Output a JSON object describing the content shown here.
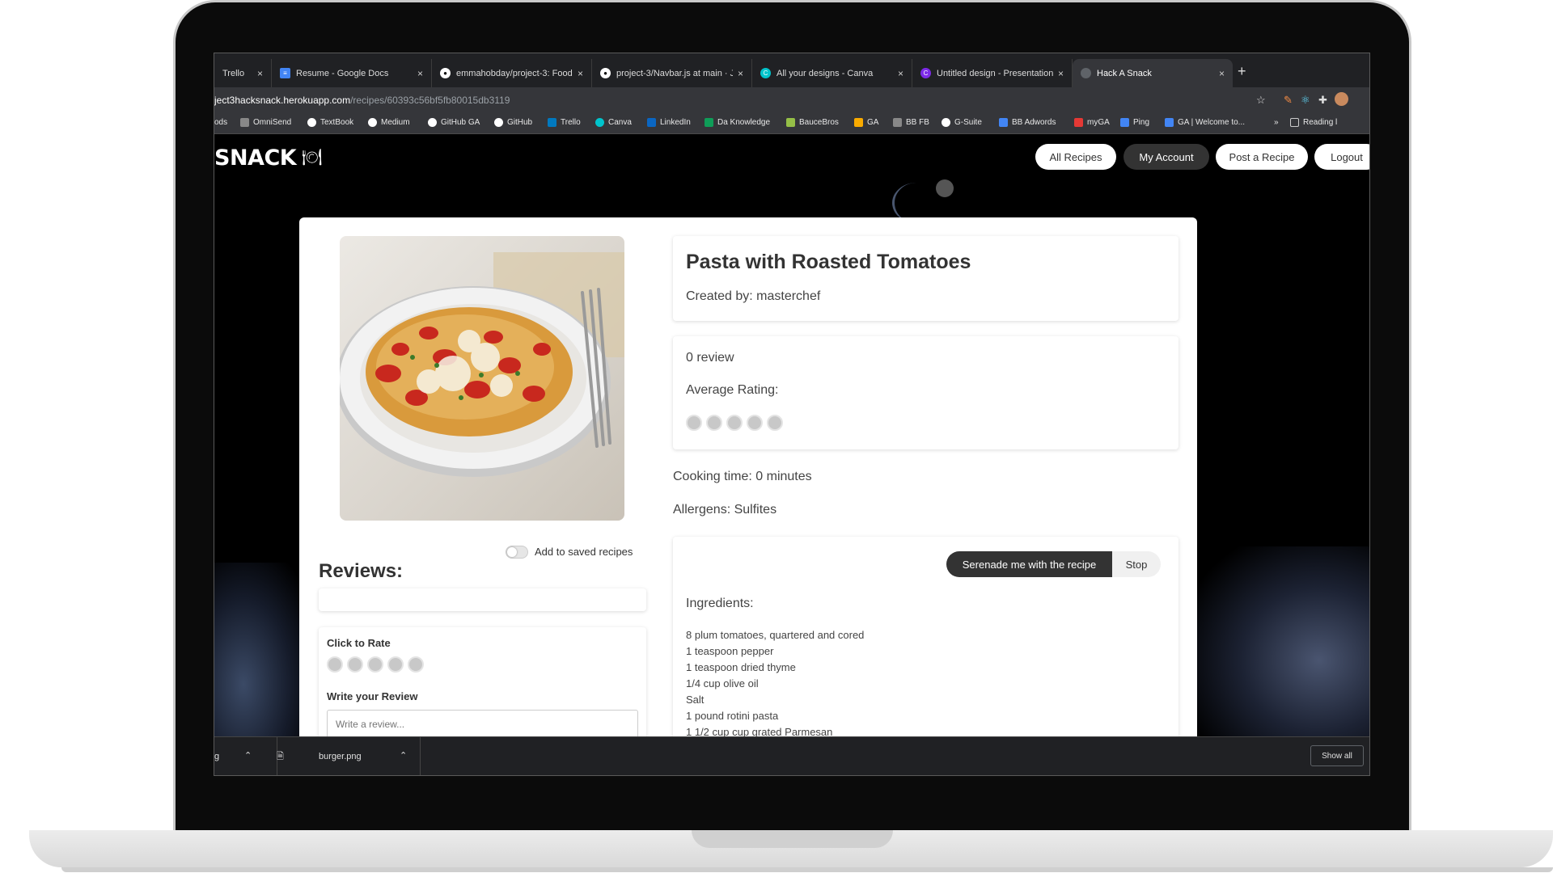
{
  "browser": {
    "tabs": [
      {
        "label": "Trello",
        "icon": "trello-icon"
      },
      {
        "label": "Resume - Google Docs",
        "icon": "google-docs-icon"
      },
      {
        "label": "emmahobday/project-3: Food",
        "icon": "github-icon"
      },
      {
        "label": "project-3/Navbar.js at main · J",
        "icon": "github-icon"
      },
      {
        "label": "All your designs - Canva",
        "icon": "canva-icon"
      },
      {
        "label": "Untitled design - Presentation",
        "icon": "canva-icon"
      },
      {
        "label": "Hack A Snack",
        "icon": "globe-icon"
      }
    ],
    "tab_close": "×",
    "new_tab": "+",
    "url_host": "ject3hacksnack.herokuapp.com",
    "url_path": "/recipes/60393c56bf5fb80015db3119",
    "bookmarks": [
      "ods",
      "OmniSend",
      "TextBook",
      "Medium",
      "GitHub GA",
      "GitHub",
      "Trello",
      "Canva",
      "LinkedIn",
      "Da Knowledge",
      "BauceBros",
      "GA",
      "BB FB",
      "G-Suite",
      "BB Adwords",
      "myGA",
      "Ping",
      "GA | Welcome to...",
      "»",
      "Reading l"
    ]
  },
  "site": {
    "logo": "SNACK",
    "logo_icon": "🍽",
    "nav": {
      "all_recipes": "All Recipes",
      "my_account": "My Account",
      "post_recipe": "Post a Recipe",
      "logout": "Logout"
    }
  },
  "recipe": {
    "title": "Pasta with Roasted Tomatoes",
    "created_by": "Created by: masterchef",
    "review_count": "0 review",
    "average_rating_label": "Average Rating:",
    "average_rating": 0,
    "rating_max": 5,
    "cooking_time": "Cooking time: 0 minutes",
    "allergens": "Allergens: Sulfites",
    "serenade_button": "Serenade me with the recipe",
    "stop_button": "Stop",
    "ingredients_label": "Ingredients:",
    "ingredients": [
      "8 plum tomatoes, quartered and cored",
      "1 teaspoon pepper",
      "1 teaspoon dried thyme",
      "1/4 cup olive oil",
      "Salt",
      "1 pound rotini pasta",
      "1 1/2 cup cup grated Parmesan"
    ]
  },
  "reviews": {
    "save_toggle_label": "Add to saved recipes",
    "heading": "Reviews:",
    "click_to_rate": "Click to Rate",
    "write_review_label": "Write your Review",
    "review_placeholder": "Write a review..."
  },
  "downloads": {
    "item1": "g",
    "item2": "burger.png",
    "show_all": "Show all"
  },
  "colors": {
    "nav_dark": "#333333",
    "page_bg": "#000000",
    "card_bg": "#ffffff"
  }
}
